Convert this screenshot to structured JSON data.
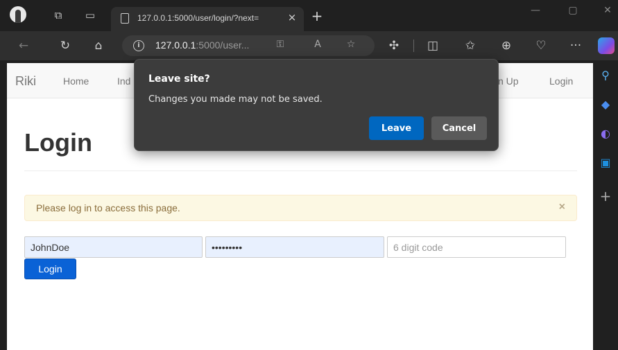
{
  "browser": {
    "tab": {
      "title": "127.0.0.1:5000/user/login/?next=",
      "close": "×"
    },
    "new_tab": "+",
    "window_controls": {
      "minimize": "—",
      "maximize": "▢",
      "close": "✕"
    },
    "address": {
      "host": "127.0.0.1",
      "rest": ":5000/user..."
    },
    "icons": {
      "back": "back-arrow-icon",
      "refresh": "refresh-icon",
      "home": "home-icon",
      "password": "key-icon",
      "read_aloud": "read-aloud-icon",
      "favorite": "star-icon",
      "extensions": "extensions-icon",
      "split": "split-screen-icon",
      "favorites": "favorites-list-icon",
      "collections": "collections-icon",
      "health": "browser-essentials-icon",
      "more": "more-icon"
    },
    "more_label": "···",
    "sidebar_add": "+"
  },
  "site": {
    "brand": "Riki",
    "nav": {
      "home": "Home",
      "index_partial": "Ind",
      "signup_partial": "n Up",
      "login": "Login"
    }
  },
  "main": {
    "title": "Login",
    "alert": {
      "text": "Please log in to access this page.",
      "close": "×"
    },
    "form": {
      "username_value": "JohnDoe",
      "password_value": "•••••••••",
      "code_placeholder": "6 digit code",
      "submit_label": "Login"
    }
  },
  "dialog": {
    "title": "Leave site?",
    "message": "Changes you made may not be saved.",
    "leave_label": "Leave",
    "cancel_label": "Cancel"
  },
  "colors": {
    "primary_button": "#0067c0",
    "login_button": "#0a62d6",
    "alert_bg": "#fcf8e3",
    "alert_text": "#8a6d3b"
  }
}
